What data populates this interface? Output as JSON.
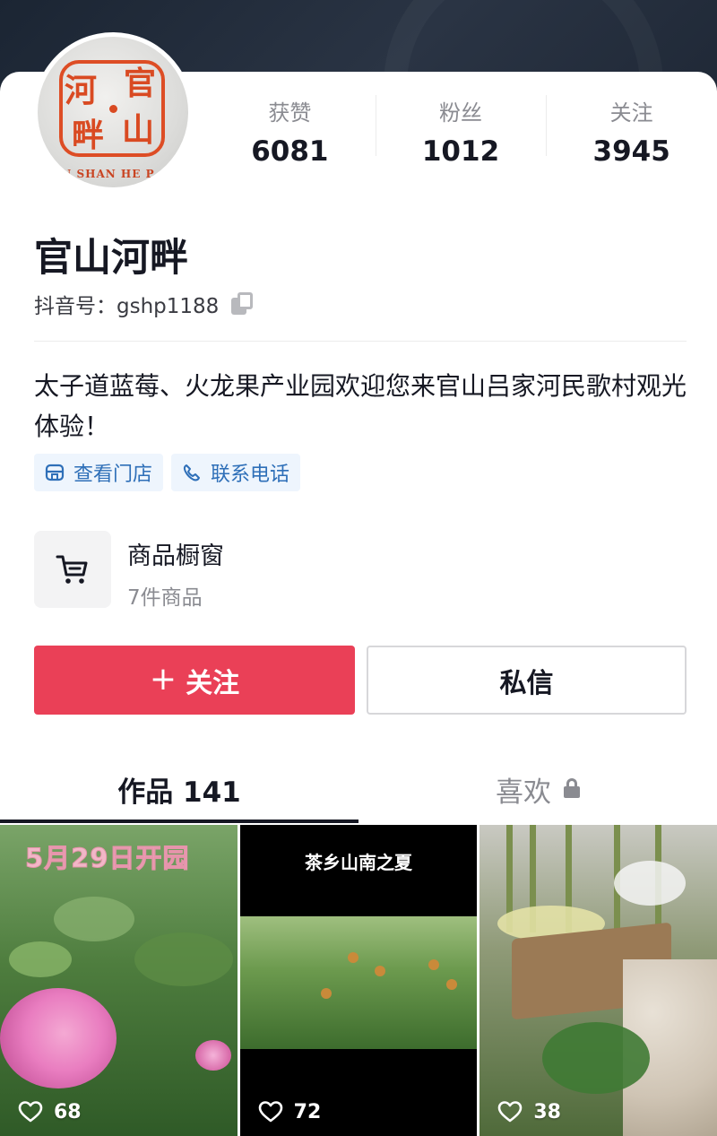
{
  "profile": {
    "name": "官山河畔",
    "douyin_id": "抖音号：gshp1188",
    "bio": "太子道蓝莓、火龙果产业园欢迎您来官山吕家河民歌村观光体验！",
    "avatar_text": [
      "河",
      "官",
      "畔",
      "山"
    ],
    "avatar_caption": "AN SHAN HE P"
  },
  "stats": [
    {
      "label": "获赞",
      "value": "6081"
    },
    {
      "label": "粉丝",
      "value": "1012"
    },
    {
      "label": "关注",
      "value": "3945"
    }
  ],
  "chips": [
    {
      "label": "查看门店",
      "icon": "store-icon"
    },
    {
      "label": "联系电话",
      "icon": "phone-icon"
    }
  ],
  "shop": {
    "title": "商品橱窗",
    "subtitle": "7件商品",
    "icon": "cart-icon"
  },
  "actions": {
    "follow_plus": "+",
    "follow_label": "关注",
    "message_label": "私信"
  },
  "tabs": {
    "works_label": "作品 141",
    "likes_label": "喜欢"
  },
  "videos": [
    {
      "overlay_text": "5月29日开园",
      "likes": "68"
    },
    {
      "overlay_text": "茶乡山南之夏",
      "likes": "72"
    },
    {
      "overlay_text": "",
      "likes": "38"
    }
  ],
  "colors": {
    "accent": "#ea4057",
    "chip_text": "#2e6fb8",
    "chip_bg": "#eef5fd"
  }
}
